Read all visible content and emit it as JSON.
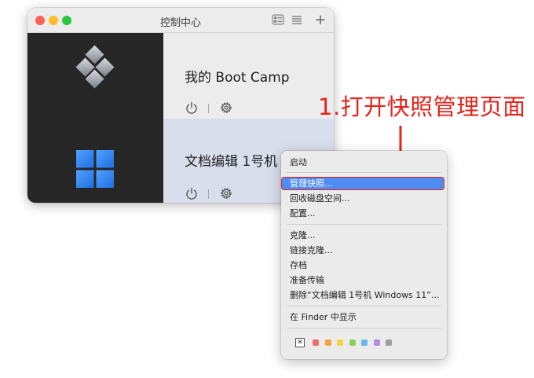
{
  "window": {
    "title": "控制中心",
    "add_label": "+"
  },
  "vms": [
    {
      "name": "我的 Boot Camp",
      "logo": "bootcamp-logo"
    },
    {
      "name": "文档编辑 1号机 Wi",
      "logo": "windows-logo"
    }
  ],
  "annotation": {
    "text": "1.打开快照管理页面",
    "color": "#e4231a"
  },
  "context_menu": {
    "items": {
      "start": "启动",
      "manage_snapshots": "管理快照...",
      "reclaim_disk": "回收磁盘空间...",
      "configure": "配置...",
      "clone": "克隆...",
      "linked_clone": "链接克隆...",
      "archive": "存档",
      "prepare_transfer": "准备传输",
      "delete": "删除“文档编辑 1号机 Windows 11”...",
      "show_in_finder": "在 Finder 中显示"
    },
    "highlight_color": "#4e8cf3",
    "tag_none_symbol": "✕",
    "tag_colors": [
      "#f26b6b",
      "#f5a346",
      "#f5d547",
      "#8ad35a",
      "#64b7f0",
      "#b98be0",
      "#9e9e9e"
    ]
  }
}
